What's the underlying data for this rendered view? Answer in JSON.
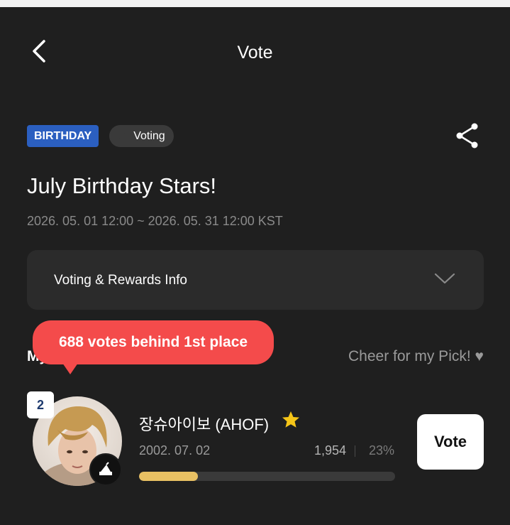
{
  "header": {
    "title": "Vote"
  },
  "event": {
    "category_tag": "BIRTHDAY",
    "status_tag": "Voting",
    "title": "July Birthday Stars!",
    "period": "2026. 05. 01 12:00 ~ 2026. 05. 31 12:00 KST"
  },
  "info_section": {
    "label": "Voting & Rewards Info"
  },
  "my_pick": {
    "label": "My Pick",
    "cheer_label": "Cheer for my Pick! ♥",
    "tooltip": "688 votes behind 1st place"
  },
  "candidate": {
    "rank": "2",
    "name": "장슈아이보 (AHOF)",
    "birthdate": "2002. 07. 02",
    "votes": "1,954",
    "percent": "23%",
    "progress_fraction": 0.23,
    "vote_button_label": "Vote"
  },
  "colors": {
    "background": "#1f1f1f",
    "birthday_tag": "#2b5fc0",
    "tooltip": "#f44b4b",
    "progress": "#e8c063",
    "star": "#f5c518"
  }
}
